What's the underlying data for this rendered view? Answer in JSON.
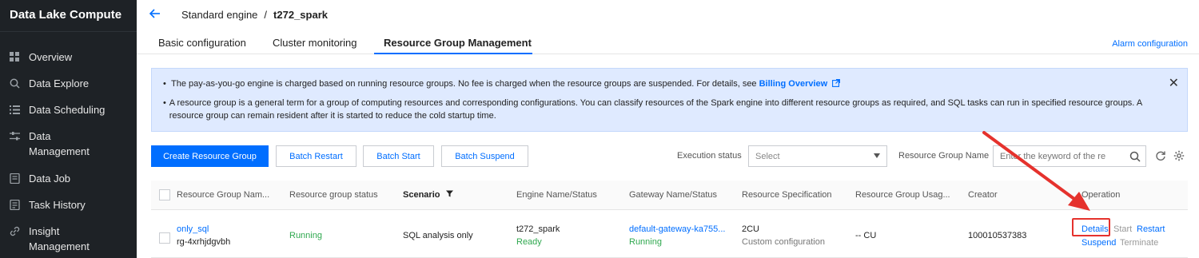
{
  "sidebar": {
    "title": "Data Lake Compute",
    "items": [
      {
        "label": "Overview",
        "icon": "grid-icon"
      },
      {
        "label": "Data Explore",
        "icon": "search-doc-icon"
      },
      {
        "label": "Data Scheduling",
        "icon": "list-icon"
      },
      {
        "label": "Data\nManagement",
        "line1": "Data",
        "line2": "Management",
        "icon": "sliders-icon"
      },
      {
        "label": "Data Job",
        "icon": "doc-icon"
      },
      {
        "label": "Task History",
        "icon": "history-doc-icon"
      },
      {
        "label": "Insight Management",
        "line1": "Insight",
        "line2": "Management",
        "icon": "link-icon"
      }
    ]
  },
  "header": {
    "breadcrumb_parent": "Standard engine",
    "breadcrumb_separator": "/",
    "breadcrumb_current": "t272_spark",
    "tabs": [
      "Basic configuration",
      "Cluster monitoring",
      "Resource Group Management"
    ],
    "active_tab": "Resource Group Management",
    "alarm_link": "Alarm configuration"
  },
  "notice": {
    "line1": "The pay-as-you-go engine is charged based on running resource groups. No fee is charged when the resource groups are suspended. For details, see ",
    "line1_link": "Billing Overview",
    "line2": "A resource group is a general term for a group of computing resources and corresponding configurations. You can classify resources of the Spark engine into different resource groups as required, and SQL tasks can run in specified resource groups. A resource group can remain resident after it is started to reduce the cold startup time."
  },
  "toolbar": {
    "create_button": "Create Resource Group",
    "batch_restart": "Batch Restart",
    "batch_start": "Batch Start",
    "batch_suspend": "Batch Suspend",
    "execution_status_label": "Execution status",
    "execution_status_placeholder": "Select",
    "resource_group_name_label": "Resource Group Name",
    "search_placeholder": "Enter the keyword of the re"
  },
  "table": {
    "columns": [
      "Resource Group Nam...",
      "Resource group status",
      "Scenario",
      "Engine Name/Status",
      "Gateway Name/Status",
      "Resource Specification",
      "Resource Group Usag...",
      "Creator",
      "Operation"
    ],
    "rows": [
      {
        "name": "only_sql",
        "id": "rg-4xrhjdgvbh",
        "status": "Running",
        "scenario": "SQL analysis only",
        "engine_name": "t272_spark",
        "engine_status": "Ready",
        "gateway_name": "default-gateway-ka755...",
        "gateway_status": "Running",
        "spec": "2CU",
        "spec_note": "Custom configuration",
        "usage": "-- CU",
        "creator": "100010537383",
        "ops": {
          "details": "Details",
          "start": "Start",
          "restart": "Restart",
          "suspend": "Suspend",
          "terminate": "Terminate"
        }
      }
    ]
  },
  "colors": {
    "accent": "#006eff",
    "running": "#2fa84f",
    "highlight": "#e5322d",
    "sidebar_bg": "#1e2226"
  }
}
